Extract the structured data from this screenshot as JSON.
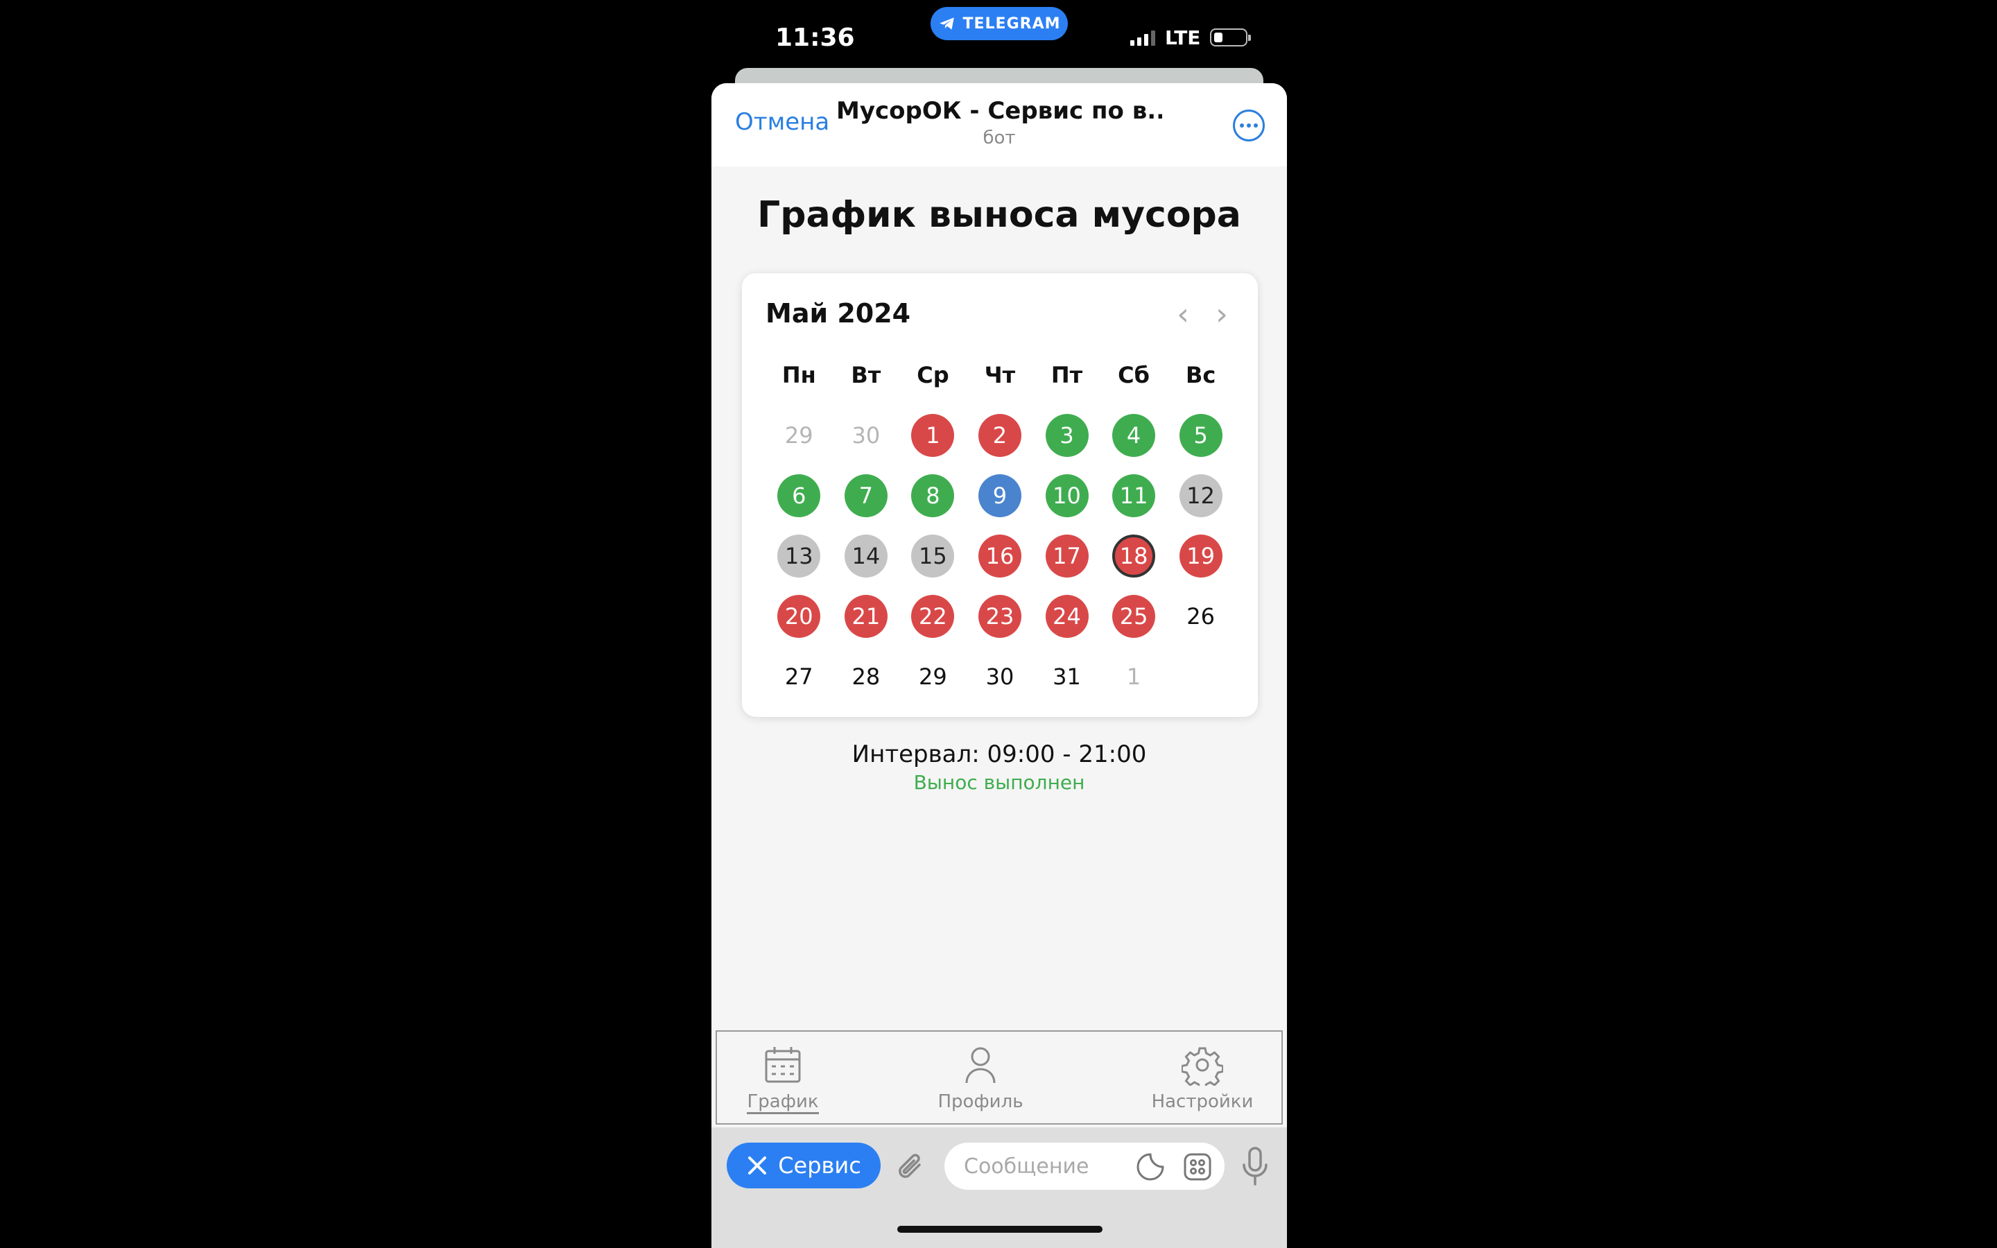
{
  "status_bar": {
    "time": "11:36",
    "app_pill": "TELEGRAM",
    "network": "LTE"
  },
  "header": {
    "cancel": "Отмена",
    "title": "МусорОК - Сервис по в...",
    "subtitle": "бот"
  },
  "page": {
    "title": "График выноса мусора",
    "calendar": {
      "month": "Май 2024",
      "weekdays": [
        "Пн",
        "Вт",
        "Ср",
        "Чт",
        "Пт",
        "Сб",
        "Вс"
      ],
      "weeks": [
        [
          {
            "d": "29",
            "s": "muted"
          },
          {
            "d": "30",
            "s": "muted"
          },
          {
            "d": "1",
            "s": "red"
          },
          {
            "d": "2",
            "s": "red"
          },
          {
            "d": "3",
            "s": "green"
          },
          {
            "d": "4",
            "s": "green"
          },
          {
            "d": "5",
            "s": "green"
          }
        ],
        [
          {
            "d": "6",
            "s": "green"
          },
          {
            "d": "7",
            "s": "green"
          },
          {
            "d": "8",
            "s": "green"
          },
          {
            "d": "9",
            "s": "blue"
          },
          {
            "d": "10",
            "s": "green"
          },
          {
            "d": "11",
            "s": "green"
          },
          {
            "d": "12",
            "s": "gray"
          }
        ],
        [
          {
            "d": "13",
            "s": "gray"
          },
          {
            "d": "14",
            "s": "gray"
          },
          {
            "d": "15",
            "s": "gray"
          },
          {
            "d": "16",
            "s": "red"
          },
          {
            "d": "17",
            "s": "red"
          },
          {
            "d": "18",
            "s": "red sel"
          },
          {
            "d": "19",
            "s": "red"
          }
        ],
        [
          {
            "d": "20",
            "s": "red"
          },
          {
            "d": "21",
            "s": "red"
          },
          {
            "d": "22",
            "s": "red"
          },
          {
            "d": "23",
            "s": "red"
          },
          {
            "d": "24",
            "s": "red"
          },
          {
            "d": "25",
            "s": "red"
          },
          {
            "d": "26",
            "s": "plain"
          }
        ],
        [
          {
            "d": "27",
            "s": "plain"
          },
          {
            "d": "28",
            "s": "plain"
          },
          {
            "d": "29",
            "s": "plain"
          },
          {
            "d": "30",
            "s": "plain"
          },
          {
            "d": "31",
            "s": "plain"
          },
          {
            "d": "1",
            "s": "muted"
          },
          {
            "d": "",
            "s": "plain"
          }
        ]
      ],
      "selected_day": "18"
    },
    "interval": "Интервал: 09:00 - 21:00",
    "status": "Вынос выполнен"
  },
  "tabs": {
    "schedule": "График",
    "profile": "Профиль",
    "settings": "Настройки"
  },
  "message_bar": {
    "service_button": "Сервис",
    "placeholder": "Сообщение"
  },
  "colors": {
    "red": "#d94848",
    "green": "#3fad4f",
    "blue": "#4a84cf",
    "gray": "#c4c4c4",
    "accent": "#2b7ff2"
  },
  "icons": [
    "telegram-icon",
    "chevron-left-icon",
    "chevron-right-icon",
    "calendar-icon",
    "user-icon",
    "gear-icon",
    "close-icon",
    "paperclip-icon",
    "sticker-icon",
    "apps-icon",
    "microphone-icon",
    "more-icon"
  ]
}
